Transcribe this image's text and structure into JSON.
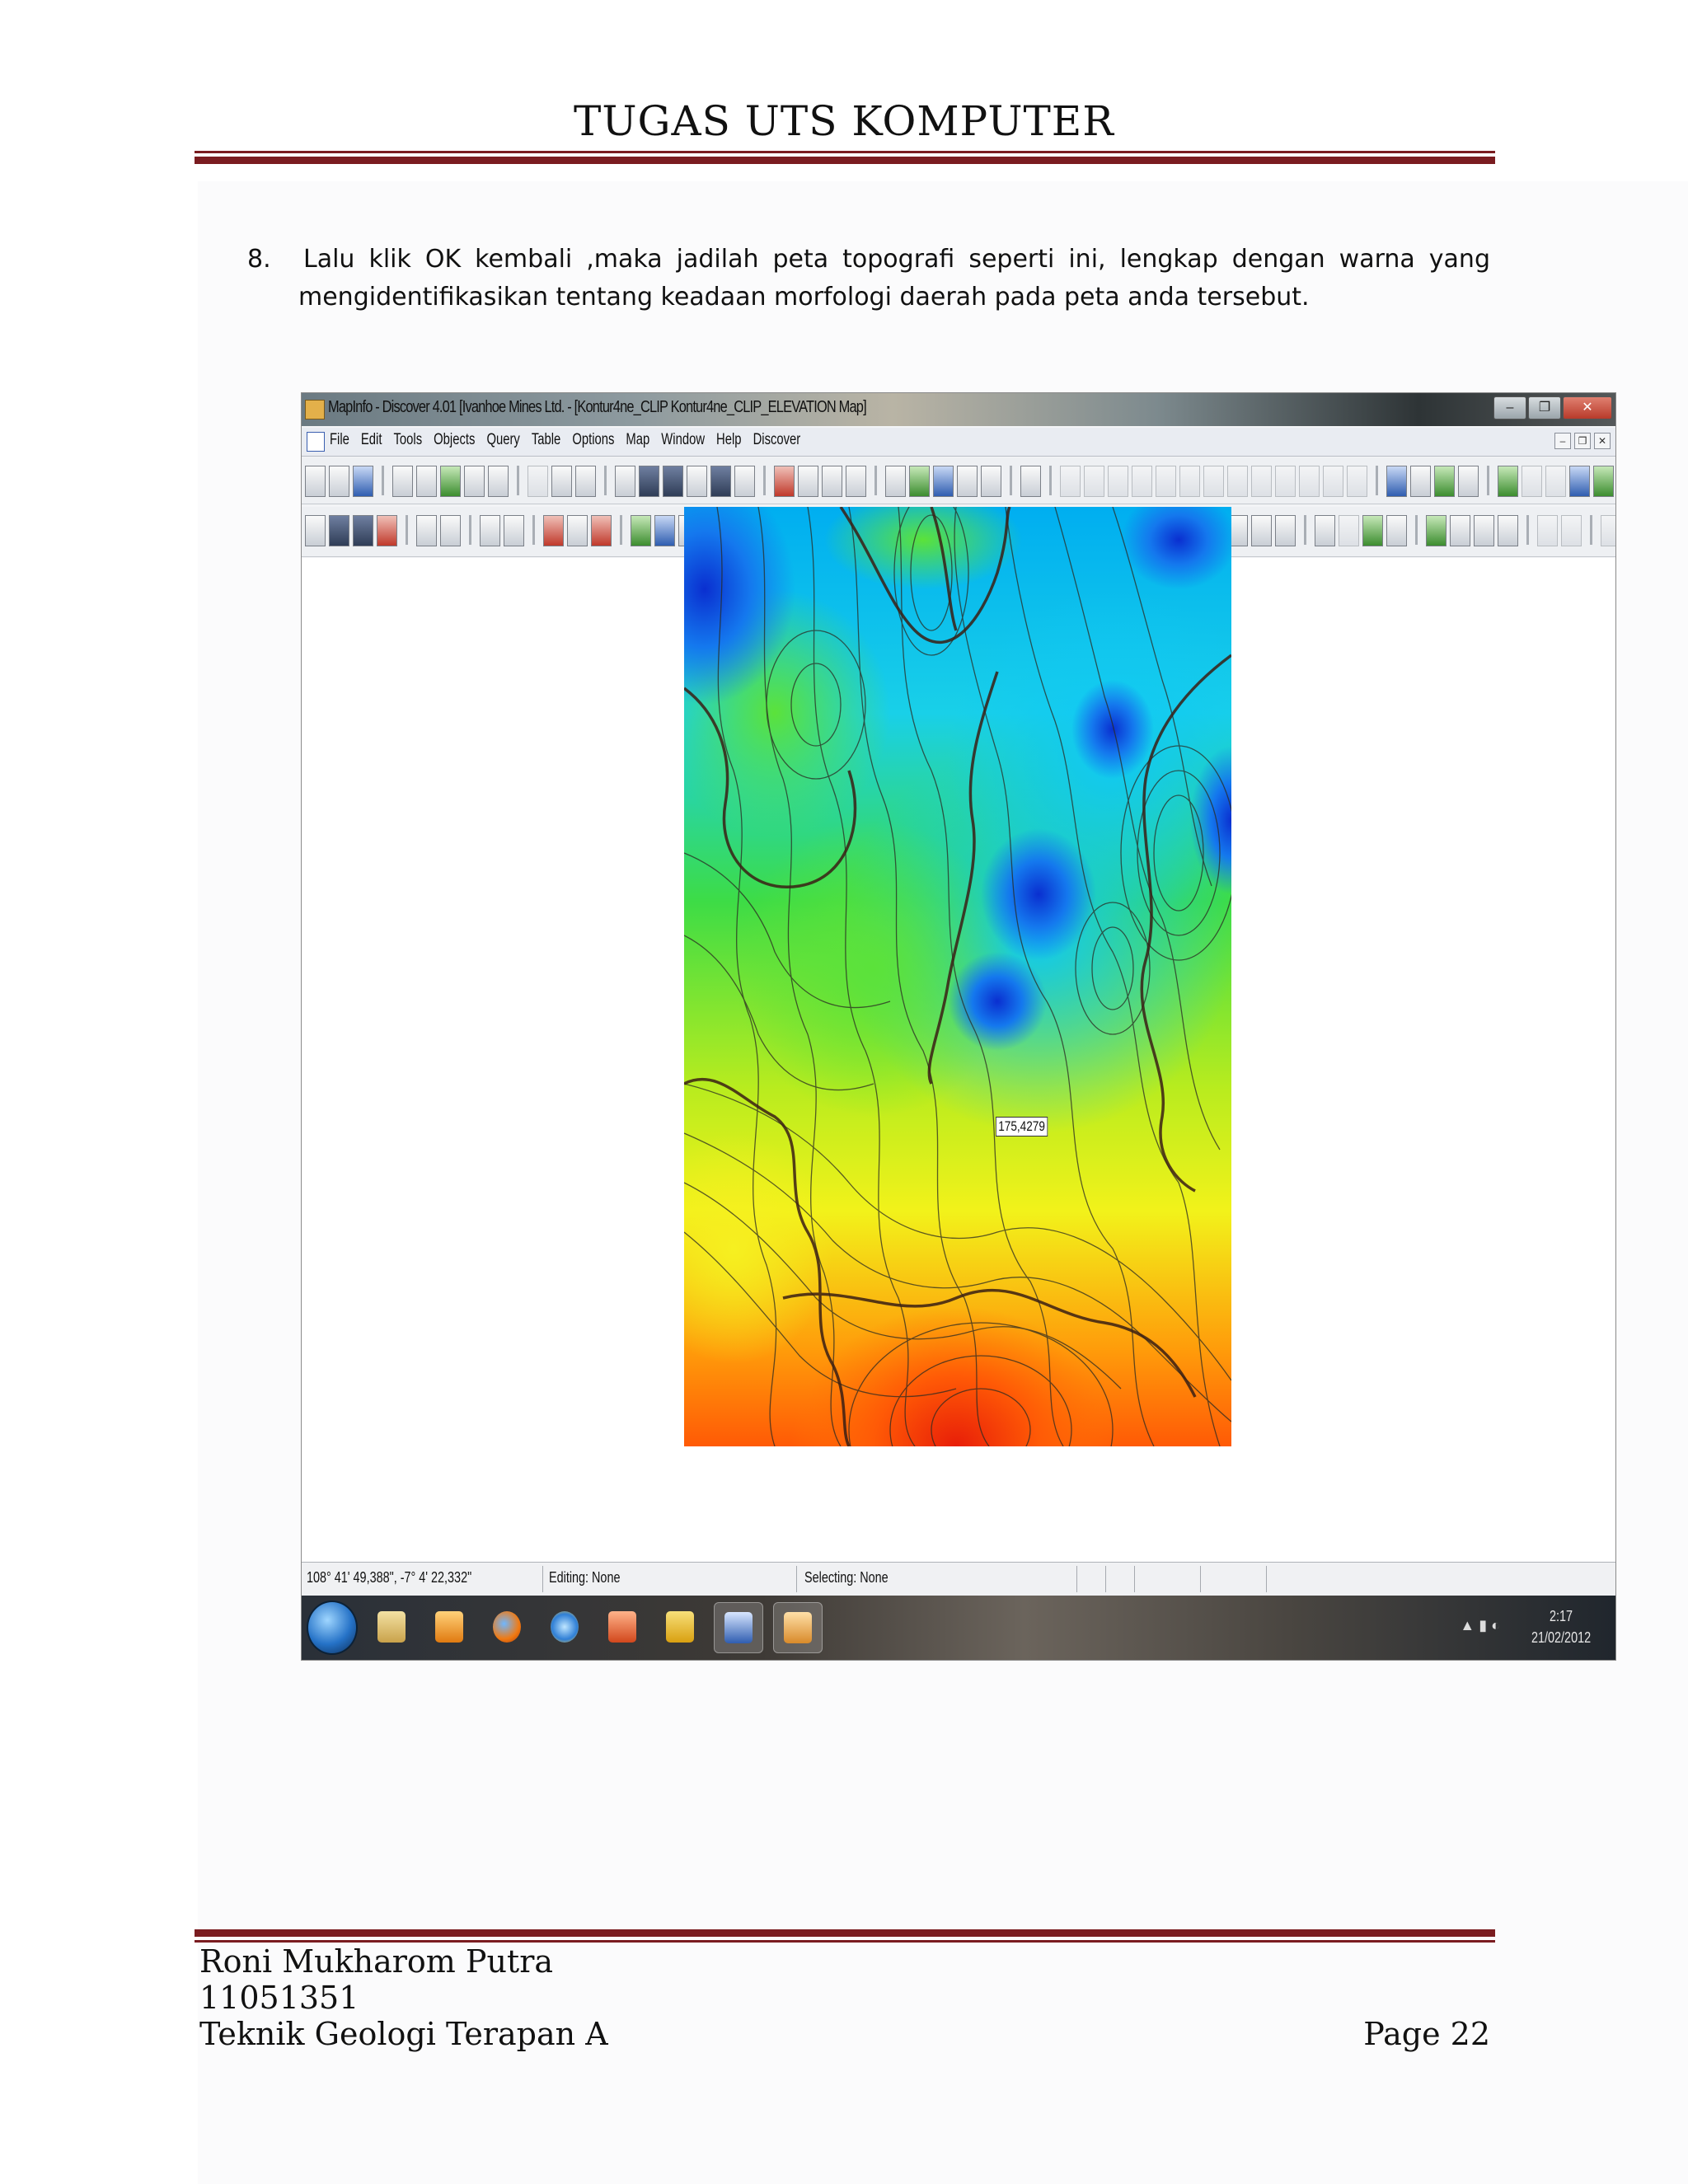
{
  "header": {
    "title": "TUGAS UTS KOMPUTER"
  },
  "paragraph": {
    "number": "8.",
    "line1": "Lalu klik OK kembali ,maka jadilah peta topografi seperti ini, lengkap dengan warna yang",
    "line2": "mengidentifikasikan tentang keadaan  morfologi daerah pada peta anda  tersebut."
  },
  "screenshot": {
    "window_title": "MapInfo - Discover 4.01  [Ivanhoe Mines Ltd. - [Kontur4ne_CLIP Kontur4ne_CLIP_ELEVATION Map]",
    "window_buttons": {
      "minimize": "–",
      "restore": "❐",
      "close": "✕"
    },
    "menu": [
      "File",
      "Edit",
      "Tools",
      "Objects",
      "Query",
      "Table",
      "Options",
      "Map",
      "Window",
      "Help",
      "Discover"
    ],
    "map_value_label": "175,4279",
    "status": {
      "coordinates": "108° 41' 49,388\", -7° 4' 22,332\"",
      "editing": "Editing: None",
      "selecting": "Selecting: None"
    },
    "taskbar": {
      "time": "2:17",
      "date": "21/02/2012",
      "apps": [
        "folder-icon",
        "media-player-icon",
        "firefox-icon",
        "ie-icon",
        "powerpoint-icon",
        "winamp-icon",
        "word-icon",
        "mapinfo-icon"
      ]
    }
  },
  "footer": {
    "author": "Roni Mukharom Putra",
    "student_id": "11051351",
    "program": "Teknik Geologi Terapan A",
    "page": "Page 22"
  },
  "colors": {
    "rule": "#7a1c20",
    "map_low": "#0a2fd0",
    "map_mid": "#33dd33",
    "map_high": "#e81e08"
  }
}
